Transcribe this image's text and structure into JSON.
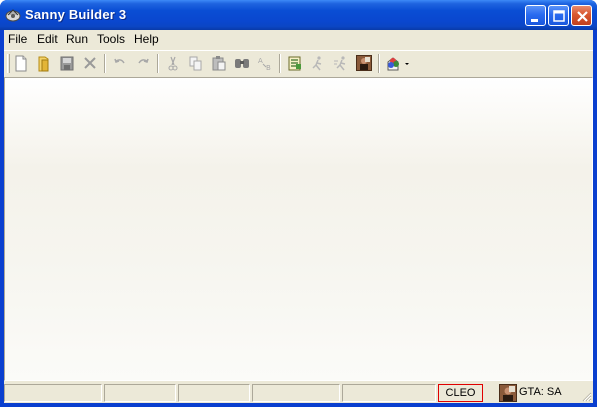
{
  "window": {
    "title": "Sanny Builder 3"
  },
  "menu": {
    "items": [
      {
        "label": "File"
      },
      {
        "label": "Edit"
      },
      {
        "label": "Run"
      },
      {
        "label": "Tools"
      },
      {
        "label": "Help"
      }
    ]
  },
  "toolbar": {
    "buttons": [
      {
        "icon": "new-file-icon",
        "enabled": true
      },
      {
        "icon": "open-folder-icon",
        "enabled": true
      },
      {
        "icon": "save-icon",
        "enabled": false
      },
      {
        "icon": "close-file-icon",
        "enabled": false
      },
      {
        "icon": "undo-icon",
        "enabled": false
      },
      {
        "icon": "redo-icon",
        "enabled": false
      },
      {
        "icon": "cut-icon",
        "enabled": false
      },
      {
        "icon": "copy-icon",
        "enabled": false
      },
      {
        "icon": "paste-icon",
        "enabled": false
      },
      {
        "icon": "find-icon",
        "enabled": false
      },
      {
        "icon": "replace-icon",
        "enabled": false
      },
      {
        "icon": "compile-icon",
        "enabled": true
      },
      {
        "icon": "run-icon",
        "enabled": false
      },
      {
        "icon": "compile-run-icon",
        "enabled": false
      },
      {
        "icon": "game-icon",
        "enabled": true
      },
      {
        "icon": "tools-dropdown-icon",
        "enabled": true
      }
    ]
  },
  "status": {
    "cleo_label": "CLEO",
    "game_label": "GTA: SA",
    "accent_border": "#e00000"
  }
}
